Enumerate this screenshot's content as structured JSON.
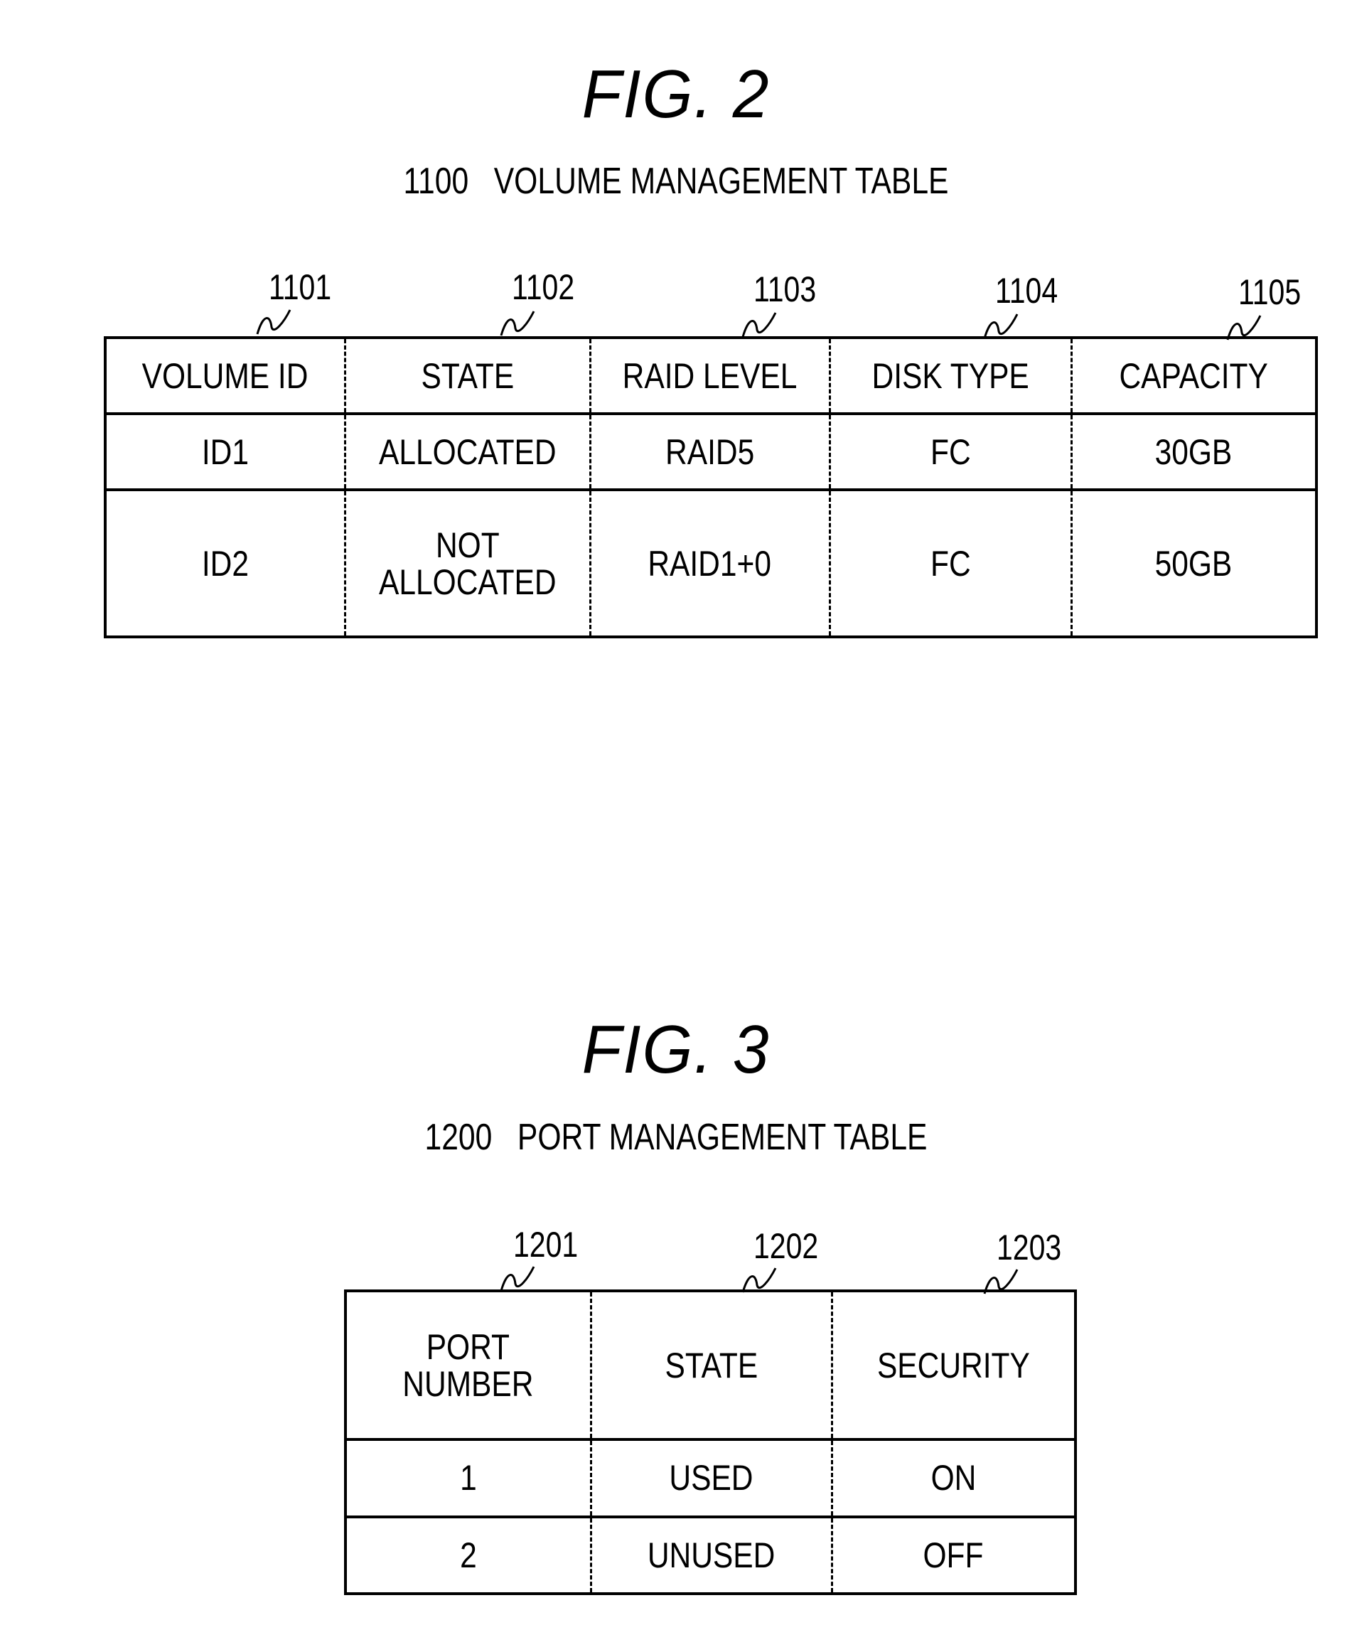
{
  "figures": [
    {
      "label": "FIG. 2",
      "subtitle": "1100   VOLUME MANAGEMENT TABLE",
      "column_refs": [
        "1101",
        "1102",
        "1103",
        "1104",
        "1105"
      ],
      "headers": [
        "VOLUME ID",
        "STATE",
        "RAID LEVEL",
        "DISK TYPE",
        "CAPACITY"
      ],
      "rows": [
        [
          "ID1",
          "ALLOCATED",
          "RAID5",
          "FC",
          "30GB"
        ],
        [
          "ID2",
          "NOT\nALLOCATED",
          "RAID1+0",
          "FC",
          "50GB"
        ]
      ]
    },
    {
      "label": "FIG. 3",
      "subtitle": "1200   PORT MANAGEMENT TABLE",
      "column_refs": [
        "1201",
        "1202",
        "1203"
      ],
      "headers": [
        "PORT\nNUMBER",
        "STATE",
        "SECURITY"
      ],
      "rows": [
        [
          "1",
          "USED",
          "ON"
        ],
        [
          "2",
          "UNUSED",
          "OFF"
        ]
      ]
    }
  ]
}
